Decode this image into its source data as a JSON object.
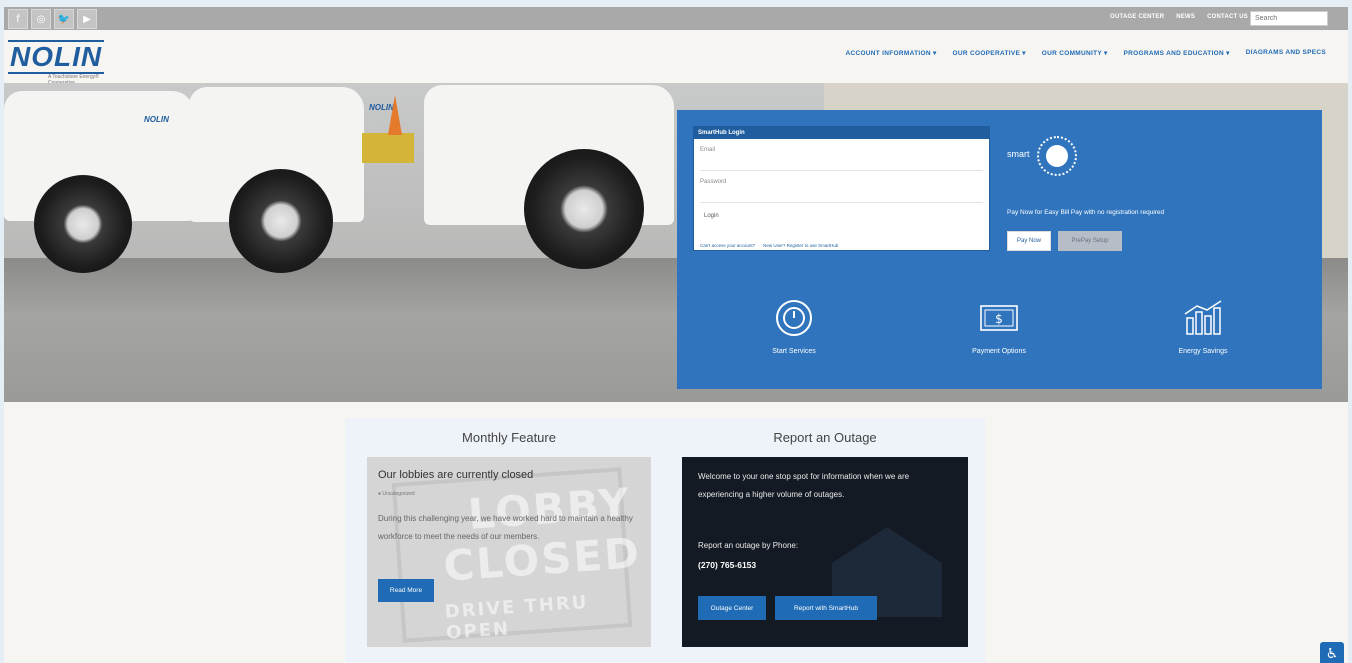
{
  "topbar": {
    "social": [
      {
        "icon": "facebook-icon",
        "glyph": "f"
      },
      {
        "icon": "instagram-icon",
        "glyph": "◎"
      },
      {
        "icon": "twitter-icon",
        "glyph": "🐦"
      },
      {
        "icon": "youtube-icon",
        "glyph": "▶"
      }
    ],
    "links": [
      "OUTAGE CENTER",
      "NEWS",
      "CONTACT US"
    ],
    "search_placeholder": "Search"
  },
  "header": {
    "logo_text": "NOLIN",
    "logo_sub": "A Touchstone Energy® Cooperative",
    "nav": [
      "ACCOUNT INFORMATION ▾",
      "OUR COOPERATIVE ▾",
      "OUR COMMUNITY ▾",
      "PROGRAMS AND EDUCATION ▾",
      "DIAGRAMS AND SPECS"
    ]
  },
  "hero": {
    "truck_logo": "NOLIN"
  },
  "panel": {
    "login_title": "SmartHub Login",
    "email_label": "Email",
    "password_label": "Password",
    "login_button": "Login",
    "forgot_link": "Can't access your account?",
    "register_link": "New User? Register to use SmartHub",
    "smarthub_text": "smart",
    "paynow_text": "Pay Now for Easy Bill Pay with no registration required",
    "paynow_button": "Pay Now",
    "prepay_button": "PrePay Setup",
    "services": [
      {
        "label": "Start Services",
        "icon": "power-icon"
      },
      {
        "label": "Payment Options",
        "icon": "money-icon"
      },
      {
        "label": "Energy Savings",
        "icon": "energy-chart-icon"
      }
    ]
  },
  "feature": {
    "monthly_title": "Monthly Feature",
    "monthly_headline": "Our lobbies are currently closed",
    "monthly_meta": "● Uncategorized",
    "monthly_body": "During this challenging year, we have worked hard to maintain a healthy workforce to meet the needs of our members.",
    "read_more": "Read More",
    "sign_word1": "LOBBY",
    "sign_word2": "CLOSED",
    "sign_word3": "DRIVE THRU OPEN",
    "outage_title": "Report an Outage",
    "outage_body": "Welcome to your one stop spot for information when we are experiencing a higher volume of outages.",
    "outage_phone_label": "Report an outage by Phone:",
    "outage_phone": "(270) 765-6153",
    "outage_center_button": "Outage Center",
    "report_smarthub_button": "Report with SmartHub"
  },
  "accessibility": {
    "icon": "accessibility-icon",
    "glyph": "♿"
  }
}
